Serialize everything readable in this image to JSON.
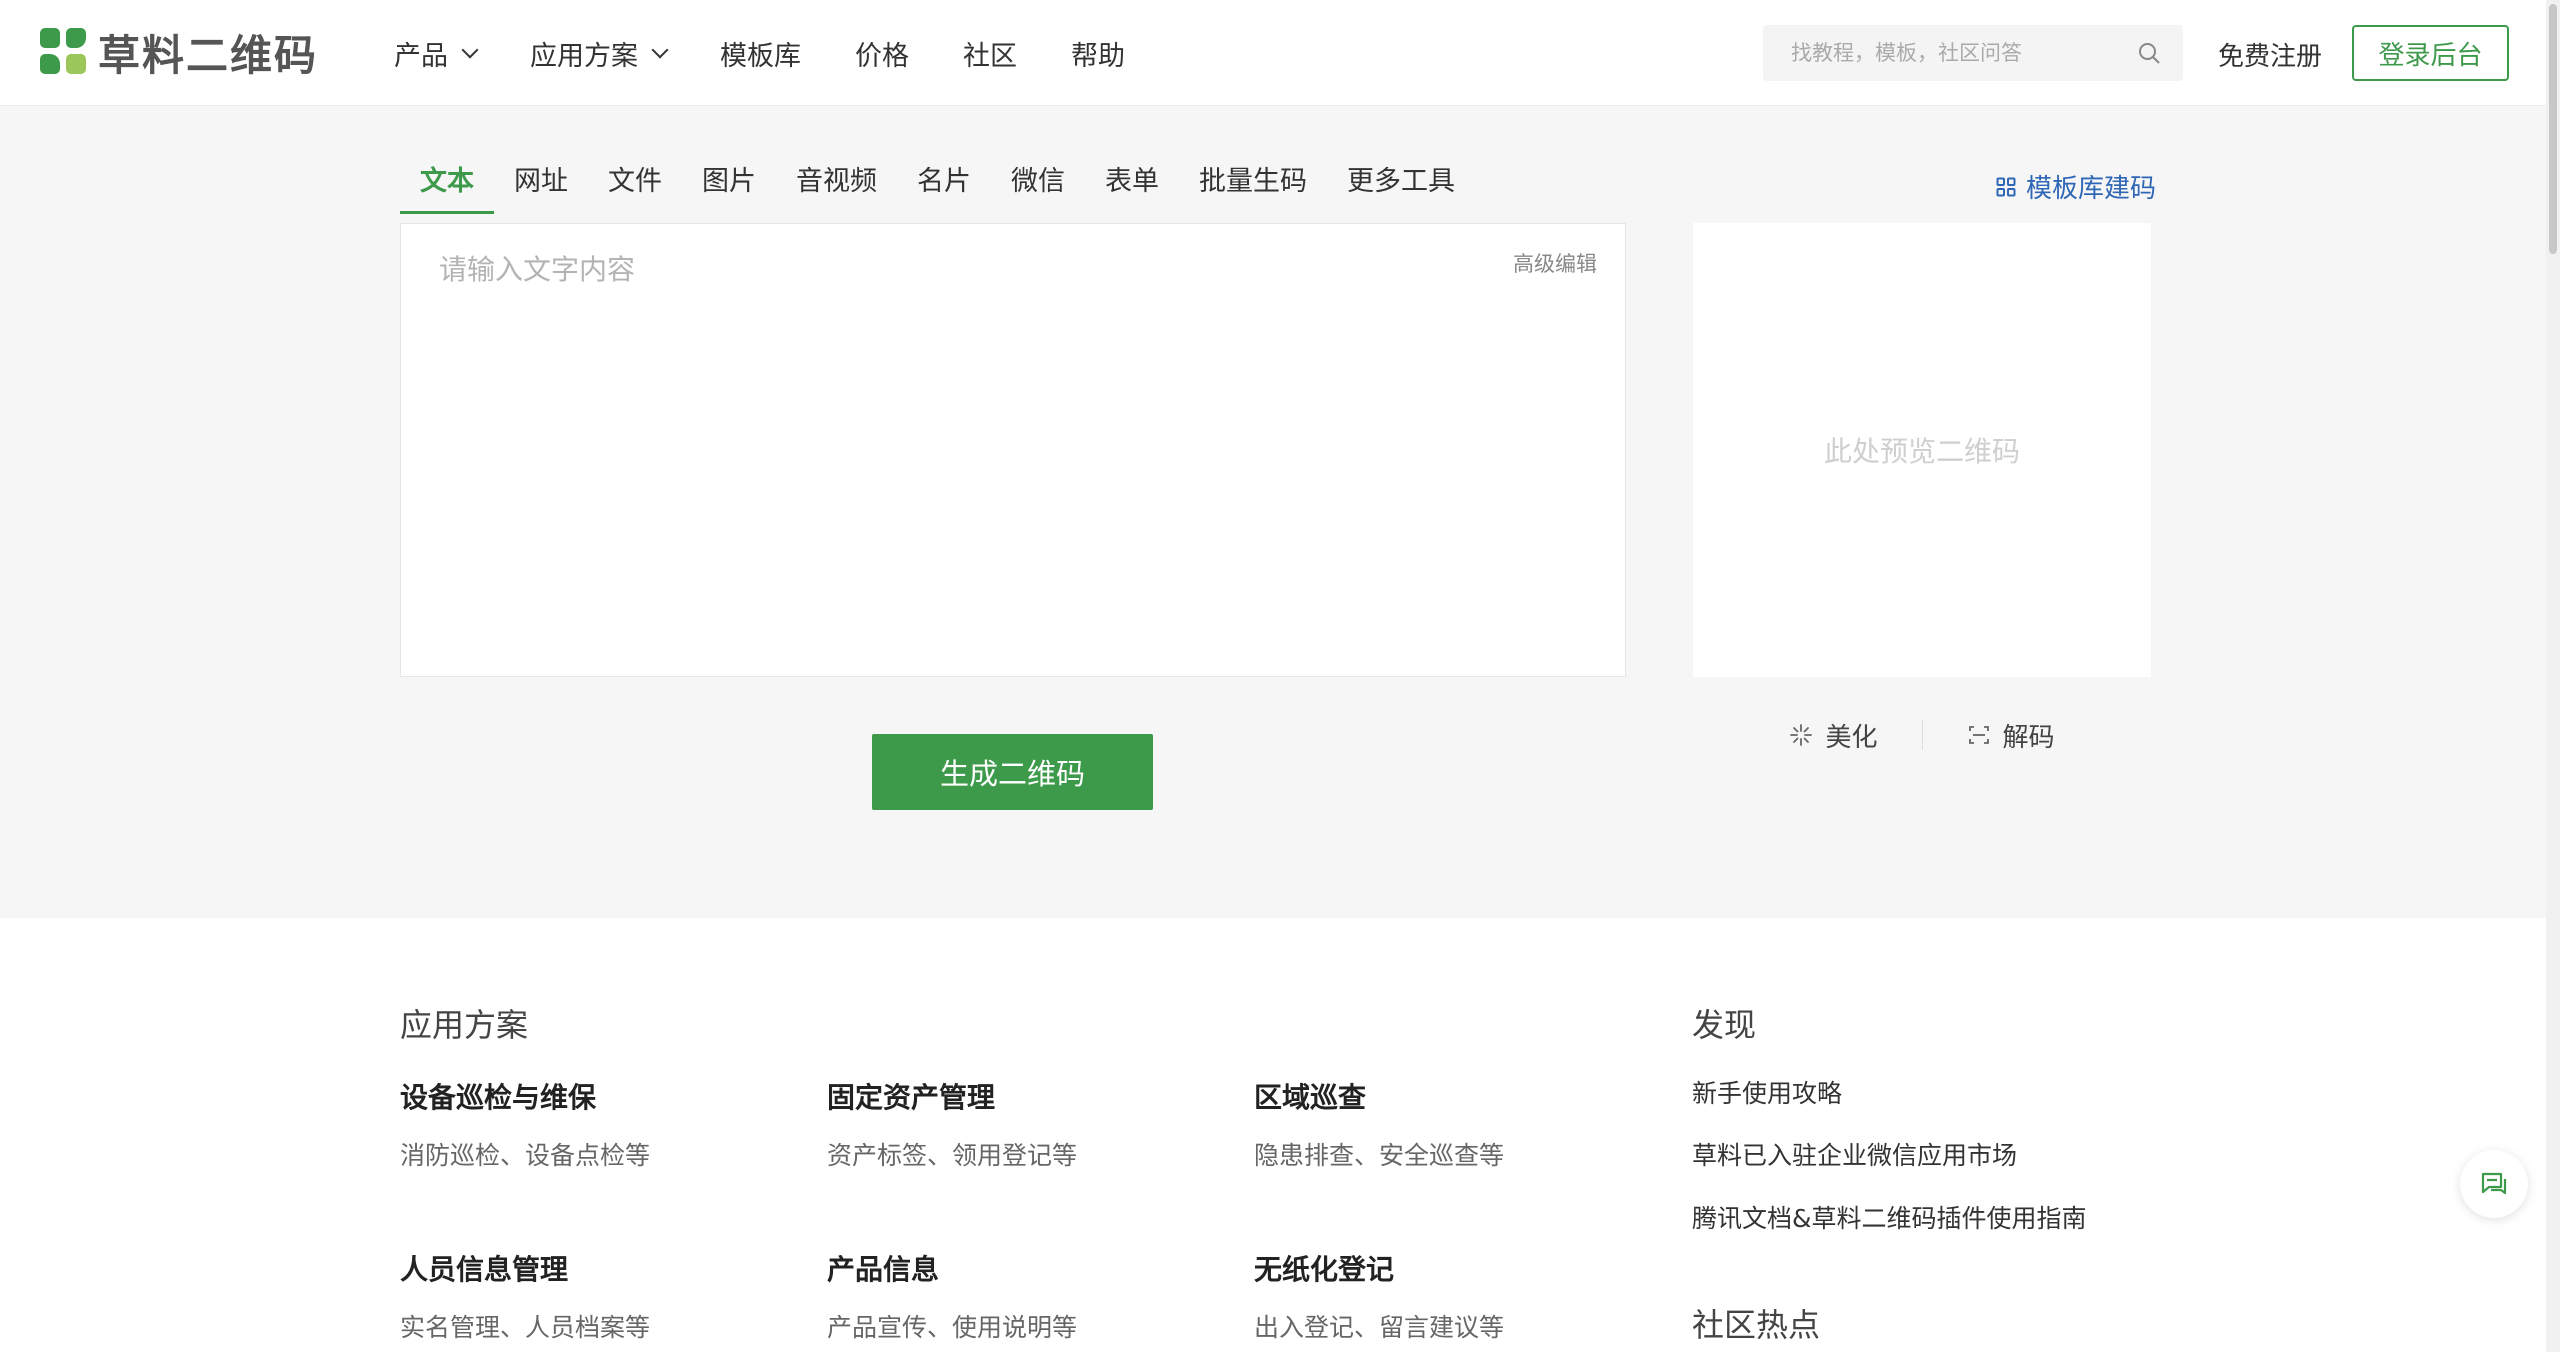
{
  "header": {
    "logo_text": "草料二维码",
    "nav": [
      {
        "label": "产品",
        "dropdown": true
      },
      {
        "label": "应用方案",
        "dropdown": true
      },
      {
        "label": "模板库",
        "dropdown": false
      },
      {
        "label": "价格",
        "dropdown": false
      },
      {
        "label": "社区",
        "dropdown": false
      },
      {
        "label": "帮助",
        "dropdown": false
      }
    ],
    "search_placeholder": "找教程，模板，社区问答",
    "register_label": "免费注册",
    "login_label": "登录后台"
  },
  "generator": {
    "tabs": [
      "文本",
      "网址",
      "文件",
      "图片",
      "音视频",
      "名片",
      "微信",
      "表单",
      "批量生码",
      "更多工具"
    ],
    "active_tab": 0,
    "template_link": "模板库建码",
    "input_placeholder": "请输入文字内容",
    "advanced_edit": "高级编辑",
    "generate_label": "生成二维码",
    "preview_text": "此处预览二维码",
    "beautify_label": "美化",
    "decode_label": "解码"
  },
  "solutions": {
    "title": "应用方案",
    "items": [
      {
        "title": "设备巡检与维保",
        "desc": "消防巡检、设备点检等"
      },
      {
        "title": "固定资产管理",
        "desc": "资产标签、领用登记等"
      },
      {
        "title": "区域巡查",
        "desc": "隐患排查、安全巡查等"
      },
      {
        "title": "人员信息管理",
        "desc": "实名管理、人员档案等"
      },
      {
        "title": "产品信息",
        "desc": "产品宣传、使用说明等"
      },
      {
        "title": "无纸化登记",
        "desc": "出入登记、留言建议等"
      }
    ]
  },
  "discover": {
    "title": "发现",
    "links": [
      "新手使用攻略",
      "草料已入驻企业微信应用市场",
      "腾讯文档&草料二维码插件使用指南"
    ],
    "community_title": "社区热点"
  },
  "colors": {
    "brand_green": "#3d9a4b",
    "link_blue": "#2f67b7"
  }
}
